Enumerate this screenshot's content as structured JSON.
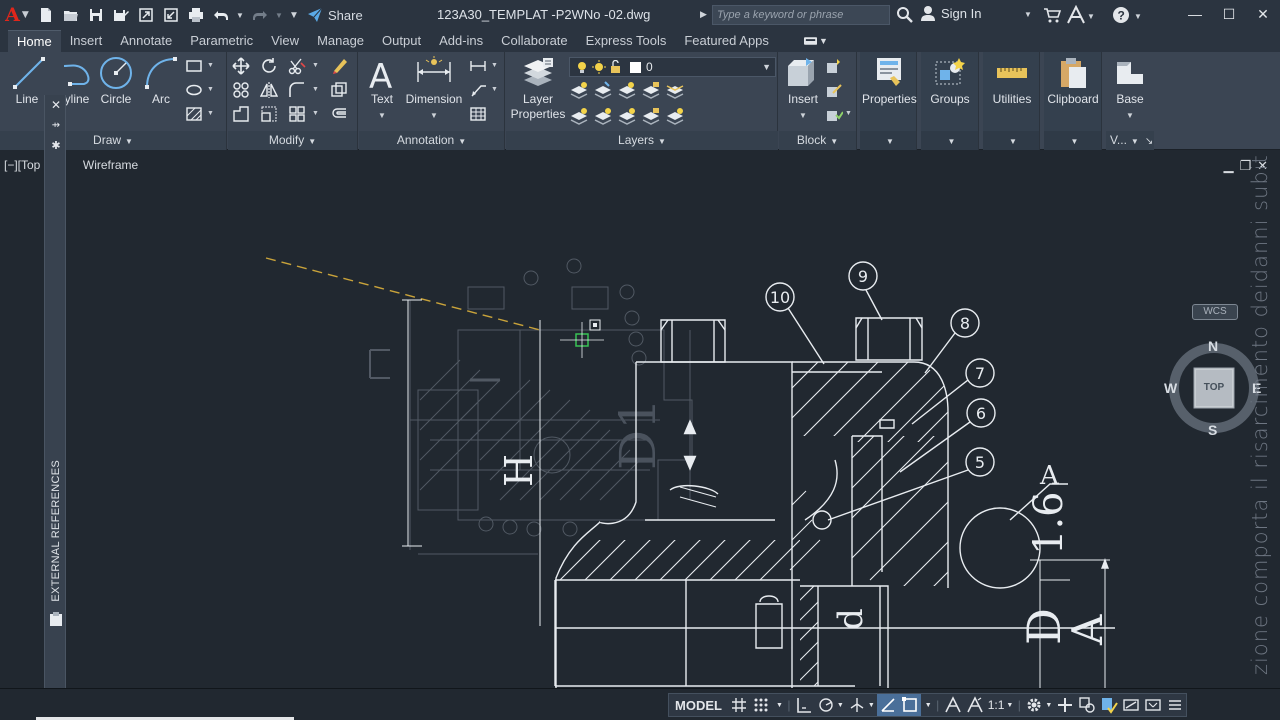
{
  "app": {
    "logo_letter": "A",
    "document_title": "123A30_TEMPLAT -P2WNo -02.dwg",
    "share_label": "Share",
    "search_placeholder": "Type a keyword or phrase",
    "sign_in_label": "Sign In"
  },
  "tabs": [
    {
      "label": "Home",
      "active": true
    },
    {
      "label": "Insert"
    },
    {
      "label": "Annotate"
    },
    {
      "label": "Parametric"
    },
    {
      "label": "View"
    },
    {
      "label": "Manage"
    },
    {
      "label": "Output"
    },
    {
      "label": "Add-ins"
    },
    {
      "label": "Collaborate"
    },
    {
      "label": "Express Tools"
    },
    {
      "label": "Featured Apps"
    }
  ],
  "ribbon": {
    "draw": {
      "title": "Draw",
      "line": "Line",
      "polyline": "yline",
      "circle": "Circle",
      "arc": "Arc"
    },
    "modify": {
      "title": "Modify"
    },
    "annotation": {
      "title": "Annotation",
      "text": "Text",
      "dimension": "Dimension"
    },
    "layers": {
      "title": "Layers",
      "layer_properties_line1": "Layer",
      "layer_properties_line2": "Properties",
      "current_layer": "0"
    },
    "block": {
      "title": "Block",
      "insert": "Insert"
    },
    "properties": "Properties",
    "groups": "Groups",
    "utilities": "Utilities",
    "clipboard": "Clipboard",
    "base": "Base",
    "view_panel_title": "V..."
  },
  "viewport": {
    "label_left": "[−][Top",
    "label_right": "Wireframe"
  },
  "palette": {
    "title": "EXTERNAL REFERENCES"
  },
  "viewcube": {
    "n": "N",
    "s": "S",
    "e": "E",
    "w": "W",
    "face": "TOP",
    "wcs": "WCS"
  },
  "side_note": "zione comporta il risarcimento deidanni subiti",
  "drawing": {
    "balloons": [
      "10",
      "9",
      "8",
      "7",
      "6",
      "5"
    ],
    "dim_D1": "D1",
    "dim_H": "H",
    "dim_d": "d",
    "dim_D": "D",
    "dim_A": "A",
    "roughness": "1.6",
    "roughness_letter": "A"
  },
  "statusbar": {
    "model": "MODEL",
    "scale": "1:1"
  },
  "colors": {
    "canvas": "#212830",
    "ribbon": "#3b4553",
    "accent": "#4a6f99",
    "logo": "#e0261b"
  }
}
